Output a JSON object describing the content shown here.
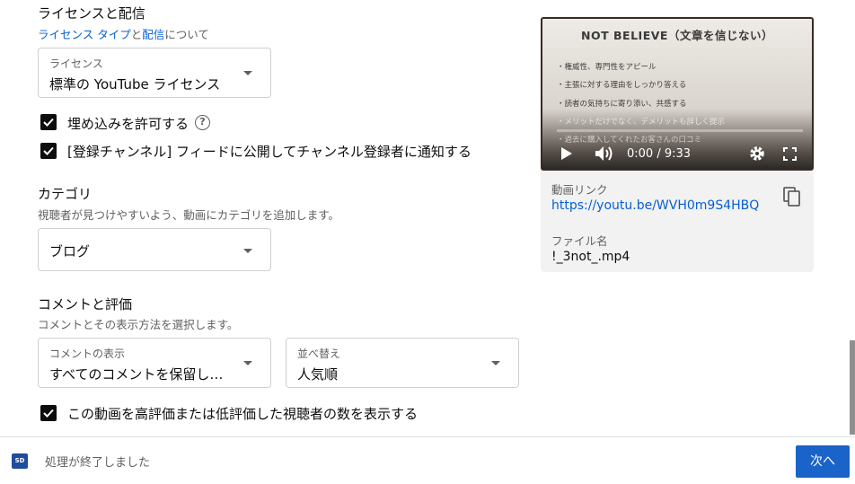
{
  "license": {
    "title": "ライセンスと配信",
    "sub_link1": "ライセンス タイプ",
    "sub_mid": "と",
    "sub_link2": "配信",
    "sub_end": "について",
    "select_label": "ライセンス",
    "select_value": "標準の YouTube ライセンス"
  },
  "checkboxes": {
    "embed": "埋め込みを許可する",
    "embed_help": "?",
    "notify": "[登録チャンネル] フィードに公開してチャンネル登録者に通知する",
    "show_ratings": "この動画を高評価または低評価した視聴者の数を表示する"
  },
  "category": {
    "title": "カテゴリ",
    "sub": "視聴者が見つけやすいよう、動画にカテゴリを追加します。",
    "value": "ブログ"
  },
  "comments": {
    "title": "コメントと評価",
    "sub": "コメントとその表示方法を選択します。",
    "visibility_label": "コメントの表示",
    "visibility_value": "すべてのコメントを保留し…",
    "sort_label": "並べ替え",
    "sort_value": "人気順"
  },
  "video": {
    "slide_title": "NOT BELIEVE（文章を信じない）",
    "bullets": [
      "・権威性、専門性をアピール",
      "・主張に対する理由をしっかり答える",
      "・読者の気持ちに寄り添い、共感する",
      "・メリットだけでなく、デメリットも詳しく提示",
      "・過去に購入してくれたお客さんの口コミ"
    ],
    "time": "0:00 / 9:33",
    "progress": 0,
    "icons": [
      "play-icon",
      "volume-icon",
      "gear-icon",
      "fullscreen-icon"
    ]
  },
  "details": {
    "link_label": "動画リンク",
    "link_value": "https://youtu.be/WVH0m9S4HBQ",
    "file_label": "ファイル名",
    "file_value": "!_3not_.mp4"
  },
  "footer": {
    "badge": "SD",
    "status": "処理が終了しました",
    "next_label": "次へ"
  },
  "colors": {
    "link": "#065fd4",
    "primary_button": "#1a63c8",
    "checkbox": "#0d0d0d"
  }
}
